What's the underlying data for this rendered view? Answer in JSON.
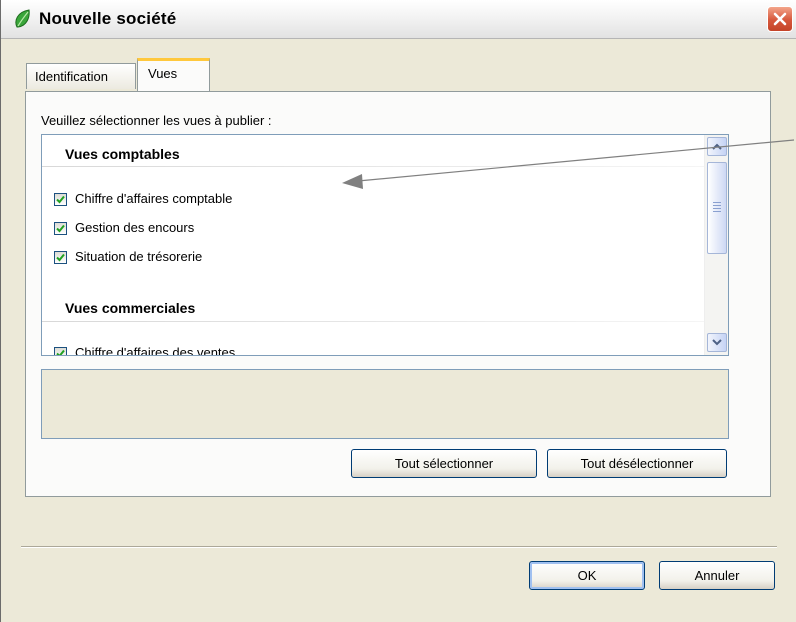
{
  "window": {
    "title": "Nouvelle société"
  },
  "tabs": [
    {
      "label": "Identification",
      "selected": false
    },
    {
      "label": "Vues",
      "selected": true
    }
  ],
  "views_panel": {
    "prompt": "Veuillez sélectionner les vues à publier :",
    "groups": [
      {
        "header": "Vues comptables",
        "items": [
          {
            "label": "Chiffre d'affaires comptable",
            "checked": true
          },
          {
            "label": "Gestion des encours",
            "checked": true
          },
          {
            "label": "Situation de trésorerie",
            "checked": true
          }
        ]
      },
      {
        "header": "Vues commerciales",
        "items": [
          {
            "label": "Chiffre d'affaires des ventes",
            "checked": true
          }
        ]
      }
    ],
    "select_all_label": "Tout sélectionner",
    "deselect_all_label": "Tout désélectionner"
  },
  "footer": {
    "ok_label": "OK",
    "cancel_label": "Annuler"
  },
  "icons": {
    "app": "green-leaf-icon",
    "close": "close-icon",
    "checkbox": "checkmark-icon",
    "scroll_up": "scroll-up-arrow-icon",
    "scroll_down": "scroll-down-arrow-icon"
  },
  "colors": {
    "accent_tab": "#ffc83c",
    "close_button": "#d6573b",
    "checkmark": "#21a121",
    "annotation_arrow": "#808080"
  }
}
